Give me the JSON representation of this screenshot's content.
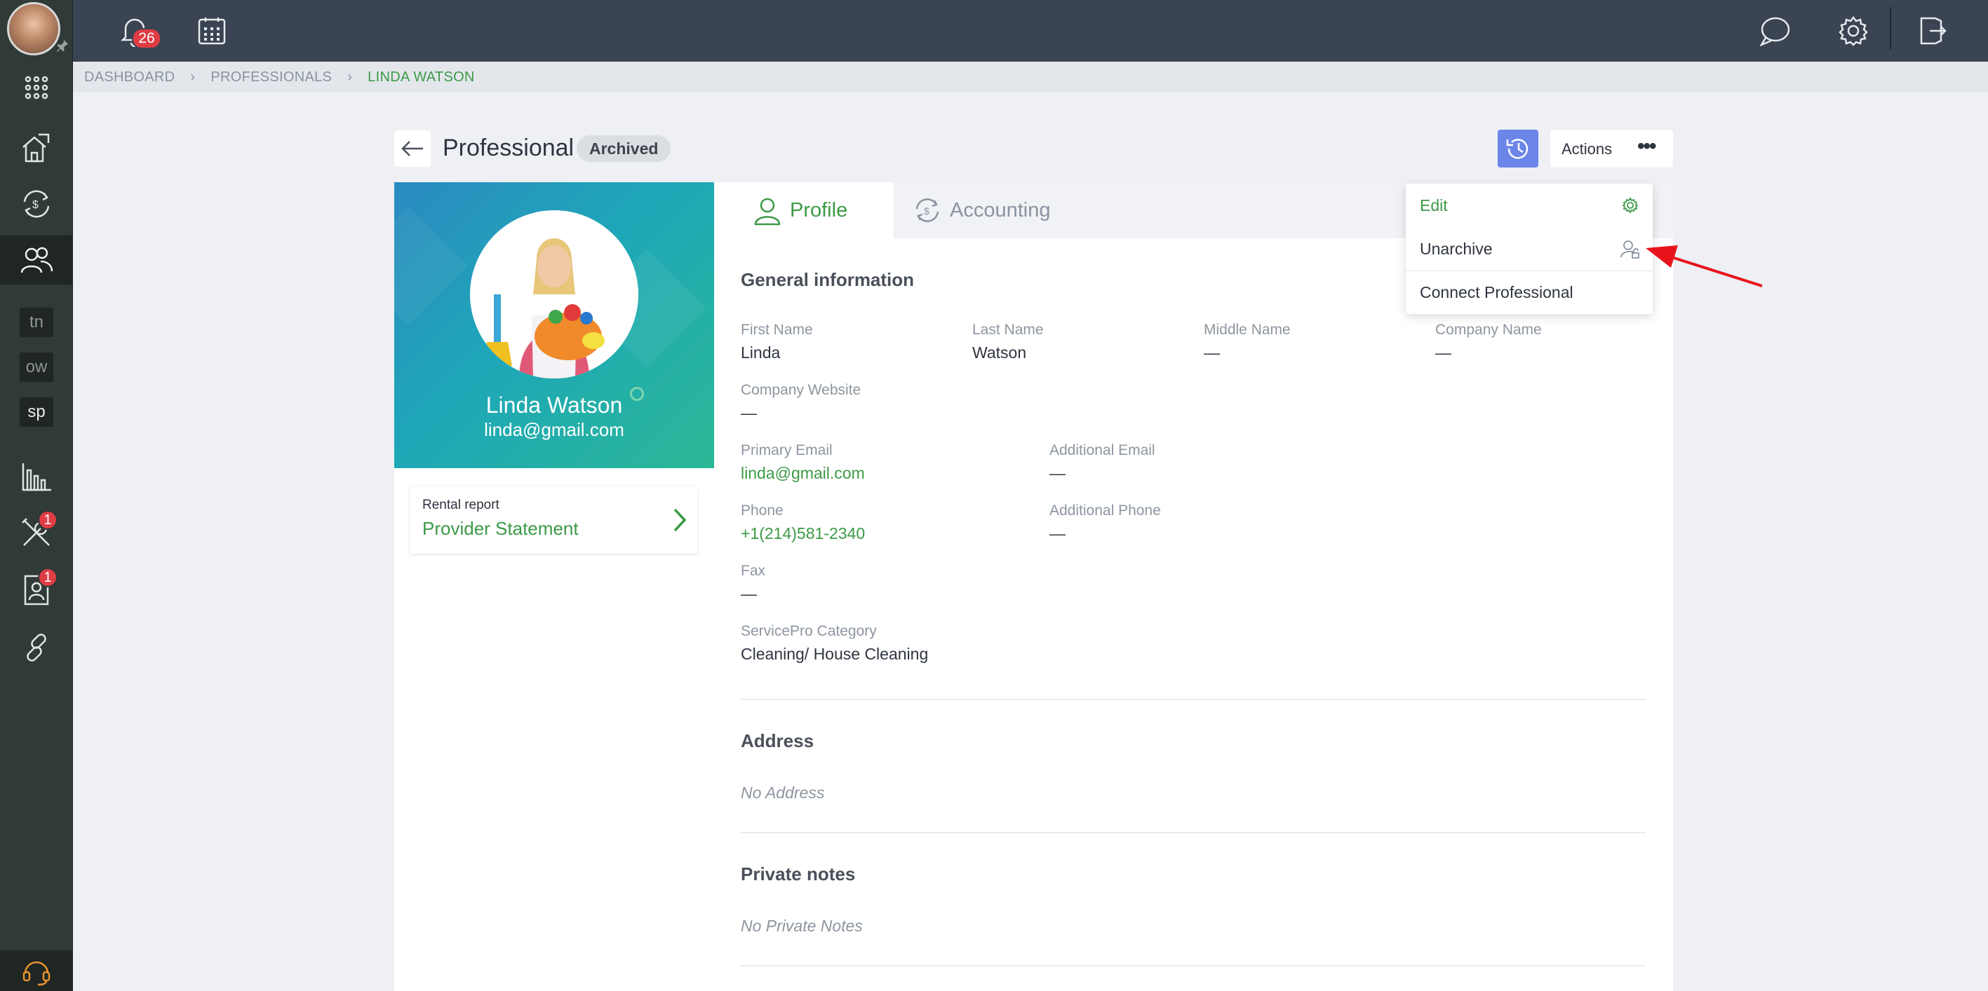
{
  "topbar": {
    "notification_count": "26"
  },
  "sidebar": {
    "abbr_items": [
      "tn",
      "ow",
      "sp"
    ],
    "tools_badge": "1",
    "contacts_badge": "1"
  },
  "breadcrumb": {
    "items": [
      "DASHBOARD",
      "PROFESSIONALS",
      "LINDA WATSON"
    ]
  },
  "header": {
    "title": "Professional",
    "status_badge": "Archived",
    "actions_label": "Actions"
  },
  "actions_menu": {
    "items": [
      "Edit",
      "Unarchive",
      "Connect Professional"
    ]
  },
  "profile_card": {
    "name": "Linda Watson",
    "email": "linda@gmail.com",
    "report_label": "Rental report",
    "report_title": "Provider Statement"
  },
  "tabs": [
    "Profile",
    "Accounting"
  ],
  "general": {
    "heading": "General information",
    "fields": {
      "first_name": {
        "label": "First Name",
        "value": "Linda"
      },
      "last_name": {
        "label": "Last Name",
        "value": "Watson"
      },
      "middle_name": {
        "label": "Middle Name",
        "value": "—"
      },
      "company_name": {
        "label": "Company Name",
        "value": "—"
      },
      "company_website": {
        "label": "Company Website",
        "value": "—"
      },
      "primary_email": {
        "label": "Primary Email",
        "value": "linda@gmail.com"
      },
      "additional_email": {
        "label": "Additional Email",
        "value": "—"
      },
      "phone": {
        "label": "Phone",
        "value": "+1(214)581-2340"
      },
      "additional_phone": {
        "label": "Additional Phone",
        "value": "—"
      },
      "fax": {
        "label": "Fax",
        "value": "—"
      },
      "category": {
        "label": "ServicePro Category",
        "value": "Cleaning/ House Cleaning"
      }
    }
  },
  "address": {
    "heading": "Address",
    "empty": "No Address"
  },
  "private_notes": {
    "heading": "Private notes",
    "empty": "No Private Notes"
  },
  "colors": {
    "accent": "#3c9a47",
    "history_button": "#6b86e8",
    "topbar": "#3a4452",
    "sidebar": "#303a36",
    "arrow": "#e8141c"
  }
}
